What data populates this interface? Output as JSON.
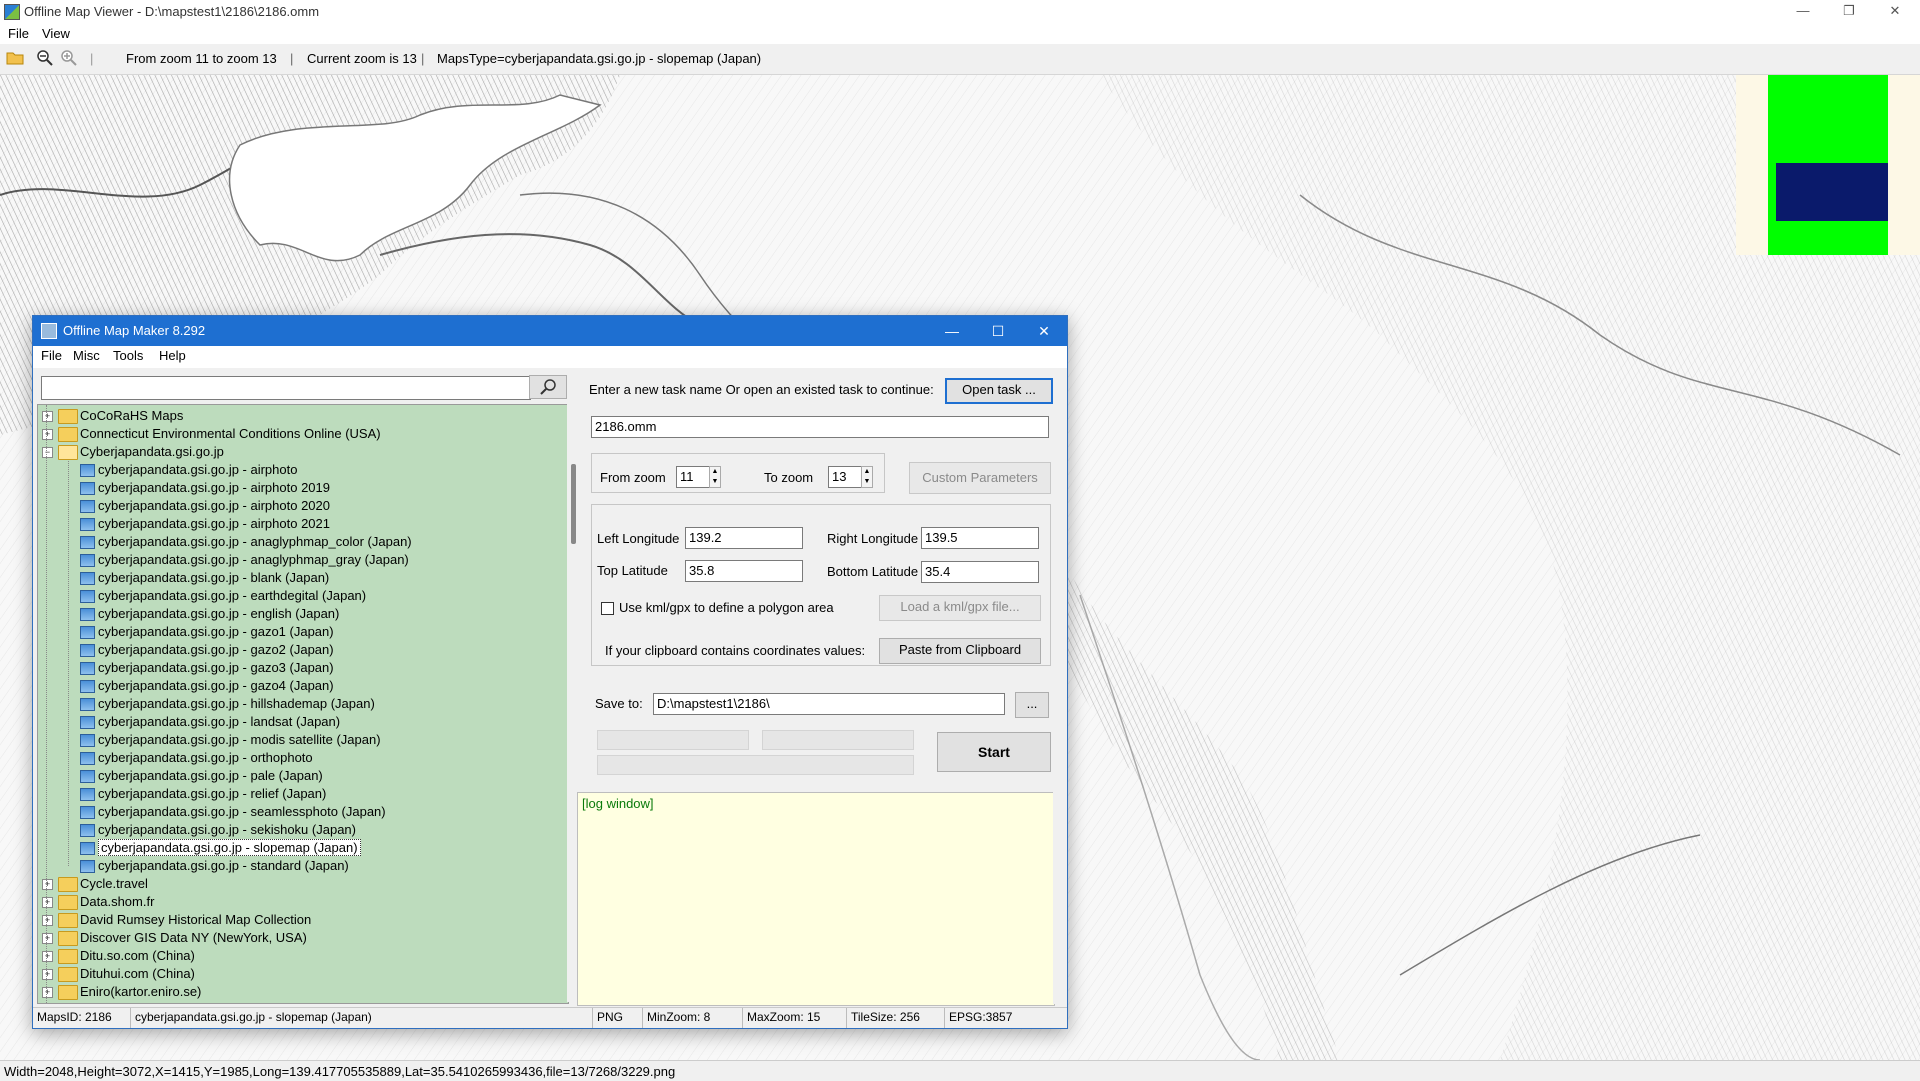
{
  "viewer": {
    "title": "Offline Map Viewer - D:\\mapstest1\\2186\\2186.omm",
    "menu": [
      "File",
      "View"
    ],
    "toolbar": {
      "zoom_range": "From zoom 11 to zoom 13",
      "current_zoom": "Current zoom is 13",
      "maps_type": "MapsType=cyberjapandata.gsi.go.jp - slopemap (Japan)",
      "sep": "|"
    },
    "status": "Width=2048,Height=3072,X=1415,Y=1985,Long=139.417705535889,Lat=35.5410265993436,file=13/7268/3229.png",
    "colors": {
      "overview_green": "#00ff00",
      "overview_blue": "#0a1a6b"
    }
  },
  "dialog": {
    "title": "Offline Map Maker 8.292",
    "menu": [
      "File",
      "Misc",
      "Tools",
      "Help"
    ],
    "search": {
      "value": "",
      "placeholder": ""
    },
    "tree": [
      {
        "label": "CoCoRaHS Maps",
        "kind": "folder",
        "level": 0
      },
      {
        "label": "Connecticut Environmental Conditions Online (USA)",
        "kind": "folder",
        "level": 0
      },
      {
        "label": "Cyberjapandata.gsi.go.jp",
        "kind": "folder-open",
        "level": 0
      },
      {
        "label": "cyberjapandata.gsi.go.jp - airphoto",
        "kind": "map",
        "level": 1
      },
      {
        "label": "cyberjapandata.gsi.go.jp - airphoto 2019",
        "kind": "map",
        "level": 1
      },
      {
        "label": "cyberjapandata.gsi.go.jp - airphoto 2020",
        "kind": "map",
        "level": 1
      },
      {
        "label": "cyberjapandata.gsi.go.jp - airphoto 2021",
        "kind": "map",
        "level": 1
      },
      {
        "label": "cyberjapandata.gsi.go.jp - anaglyphmap_color (Japan)",
        "kind": "map",
        "level": 1
      },
      {
        "label": "cyberjapandata.gsi.go.jp - anaglyphmap_gray (Japan)",
        "kind": "map",
        "level": 1
      },
      {
        "label": "cyberjapandata.gsi.go.jp - blank (Japan)",
        "kind": "map",
        "level": 1
      },
      {
        "label": "cyberjapandata.gsi.go.jp - earthdegital (Japan)",
        "kind": "map",
        "level": 1
      },
      {
        "label": "cyberjapandata.gsi.go.jp - english (Japan)",
        "kind": "map",
        "level": 1
      },
      {
        "label": "cyberjapandata.gsi.go.jp - gazo1 (Japan)",
        "kind": "map",
        "level": 1
      },
      {
        "label": "cyberjapandata.gsi.go.jp - gazo2 (Japan)",
        "kind": "map",
        "level": 1
      },
      {
        "label": "cyberjapandata.gsi.go.jp - gazo3 (Japan)",
        "kind": "map",
        "level": 1
      },
      {
        "label": "cyberjapandata.gsi.go.jp - gazo4 (Japan)",
        "kind": "map",
        "level": 1
      },
      {
        "label": "cyberjapandata.gsi.go.jp - hillshademap (Japan)",
        "kind": "map",
        "level": 1
      },
      {
        "label": "cyberjapandata.gsi.go.jp - landsat (Japan)",
        "kind": "map",
        "level": 1
      },
      {
        "label": "cyberjapandata.gsi.go.jp - modis satellite (Japan)",
        "kind": "map",
        "level": 1
      },
      {
        "label": "cyberjapandata.gsi.go.jp - orthophoto",
        "kind": "map",
        "level": 1
      },
      {
        "label": "cyberjapandata.gsi.go.jp - pale (Japan)",
        "kind": "map",
        "level": 1
      },
      {
        "label": "cyberjapandata.gsi.go.jp - relief (Japan)",
        "kind": "map",
        "level": 1
      },
      {
        "label": "cyberjapandata.gsi.go.jp - seamlessphoto (Japan)",
        "kind": "map",
        "level": 1
      },
      {
        "label": "cyberjapandata.gsi.go.jp - sekishoku (Japan)",
        "kind": "map",
        "level": 1
      },
      {
        "label": "cyberjapandata.gsi.go.jp - slopemap (Japan)",
        "kind": "map",
        "level": 1,
        "selected": true
      },
      {
        "label": "cyberjapandata.gsi.go.jp - standard (Japan)",
        "kind": "map",
        "level": 1
      },
      {
        "label": "Cycle.travel",
        "kind": "folder",
        "level": 0
      },
      {
        "label": "Data.shom.fr",
        "kind": "folder",
        "level": 0
      },
      {
        "label": "David Rumsey Historical Map Collection",
        "kind": "folder",
        "level": 0
      },
      {
        "label": "Discover GIS Data NY (NewYork, USA)",
        "kind": "folder",
        "level": 0
      },
      {
        "label": "Ditu.so.com (China)",
        "kind": "folder",
        "level": 0
      },
      {
        "label": "Dituhui.com (China)",
        "kind": "folder",
        "level": 0
      },
      {
        "label": "Eniro(kartor.eniro.se)",
        "kind": "folder",
        "level": 0
      }
    ],
    "form": {
      "task_prompt": "Enter a new task name Or open an existed task to continue:",
      "open_task": "Open task ...",
      "task_name": "2186.omm",
      "from_zoom_label": "From zoom",
      "from_zoom": "11",
      "to_zoom_label": "To zoom",
      "to_zoom": "13",
      "custom_params": "Custom Parameters",
      "left_lon_label": "Left Longitude",
      "left_lon": "139.2",
      "right_lon_label": "Right Longitude",
      "right_lon": "139.5",
      "top_lat_label": "Top Latitude",
      "top_lat": "35.8",
      "bottom_lat_label": "Bottom Latitude",
      "bottom_lat": "35.4",
      "kml_checkbox": "Use kml/gpx to define a polygon area",
      "kml_checked": false,
      "load_kml": "Load a kml/gpx file...",
      "clipboard_prompt": "If your clipboard contains coordinates values:",
      "paste_clipboard": "Paste from Clipboard",
      "save_to_label": "Save to:",
      "save_to": "D:\\mapstest1\\2186\\",
      "browse": "...",
      "start": "Start",
      "log": "[log window]"
    },
    "status": {
      "maps_id": "MapsID: 2186",
      "maps_name": "cyberjapandata.gsi.go.jp - slopemap (Japan)",
      "format": "PNG",
      "min_zoom": "MinZoom: 8",
      "max_zoom": "MaxZoom: 15",
      "tile_size": "TileSize: 256",
      "epsg": "EPSG:3857"
    }
  }
}
